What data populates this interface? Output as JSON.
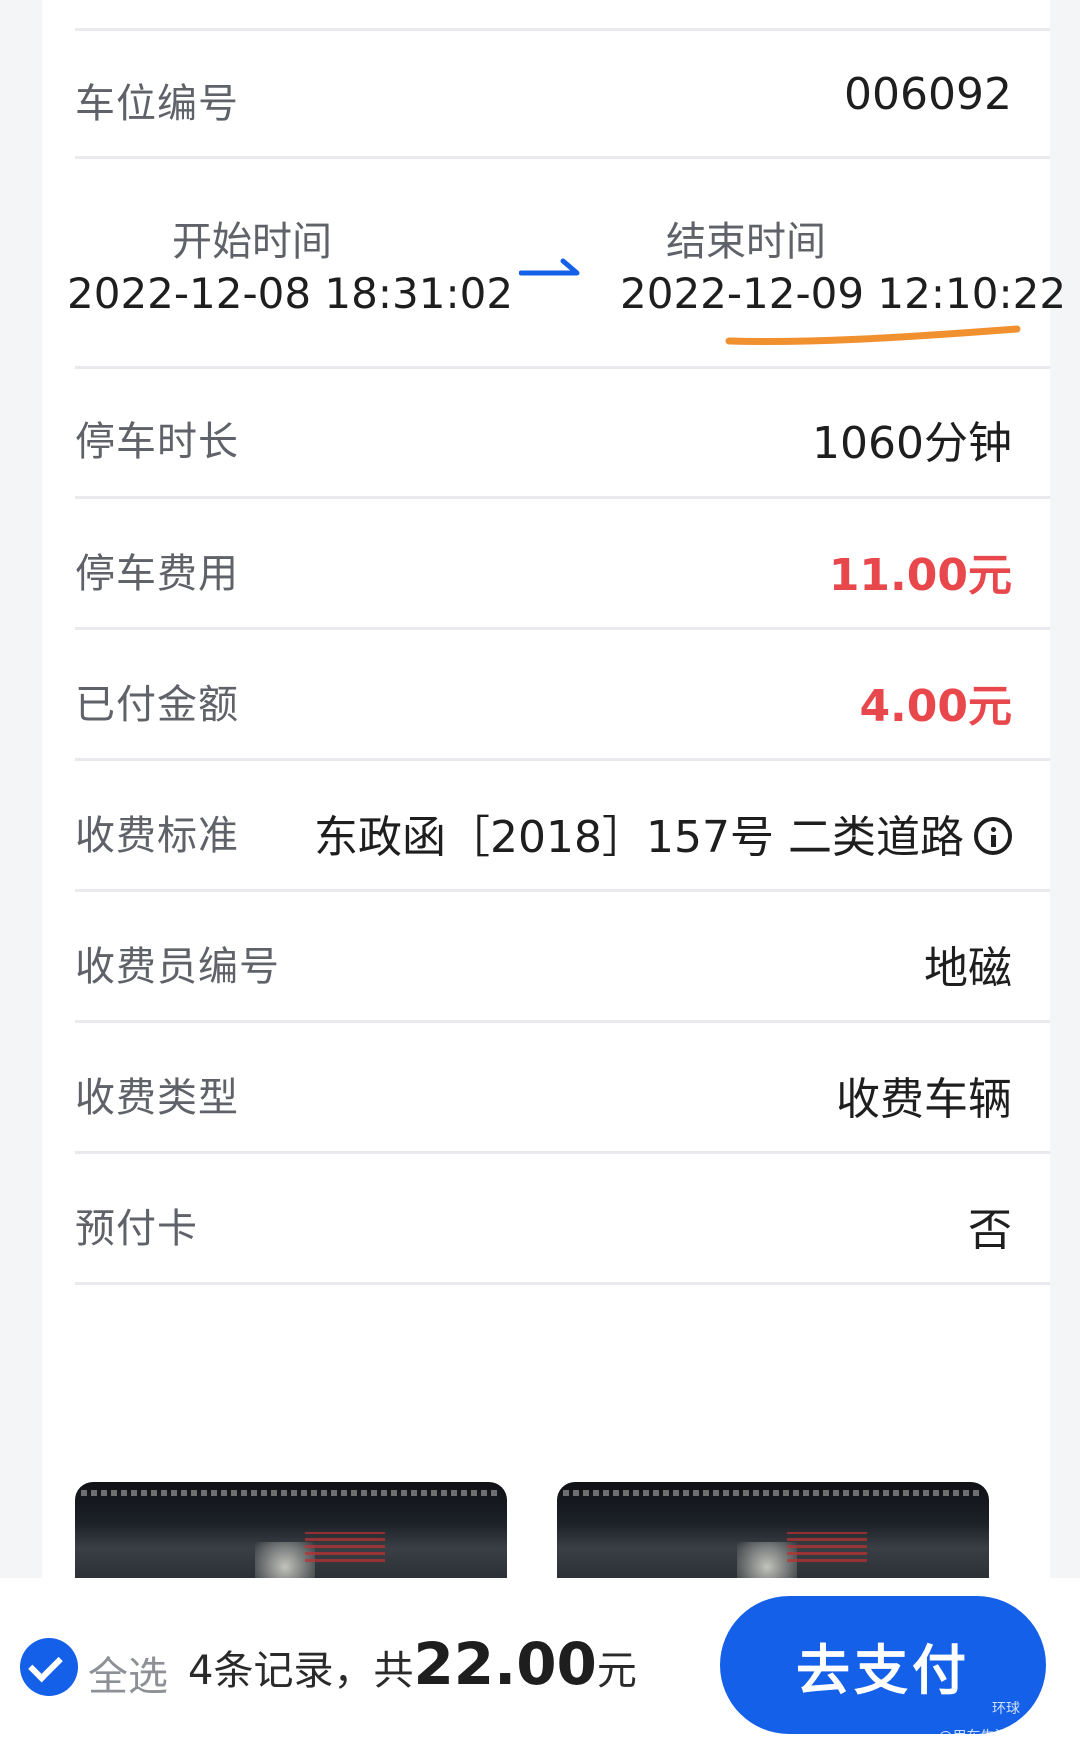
{
  "rows": {
    "space_number": {
      "label": "车位编号",
      "value": "006092"
    },
    "start_time": {
      "label": "开始时间",
      "value": "2022-12-08 18:31:02"
    },
    "end_time": {
      "label": "结束时间",
      "value": "2022-12-09 12:10:22"
    },
    "duration": {
      "label": "停车时长",
      "value": "1060分钟"
    },
    "fee": {
      "label": "停车费用",
      "value": "11.00元"
    },
    "paid": {
      "label": "已付金额",
      "value": "4.00元"
    },
    "standard": {
      "label": "收费标准",
      "value": "东政函［2018］157号 二类道路"
    },
    "collector": {
      "label": "收费员编号",
      "value": "地磁"
    },
    "fee_type": {
      "label": "收费类型",
      "value": "收费车辆"
    },
    "prepaid_card": {
      "label": "预付卡",
      "value": "否"
    }
  },
  "bottom": {
    "select_all": "全选",
    "records_prefix": "4条记录，共",
    "total": "22.00",
    "unit": "元",
    "pay_button": "去支付",
    "watermark_1": "环球",
    "watermark_2": "@用车生活网 www.t"
  },
  "icons": {
    "arrow": "right-arrow-icon",
    "info": "info-icon",
    "check": "check-circle-icon"
  },
  "colors": {
    "accent": "#1560e8",
    "fee_red": "#e8474c",
    "highlight_underline": "#f0902f"
  }
}
